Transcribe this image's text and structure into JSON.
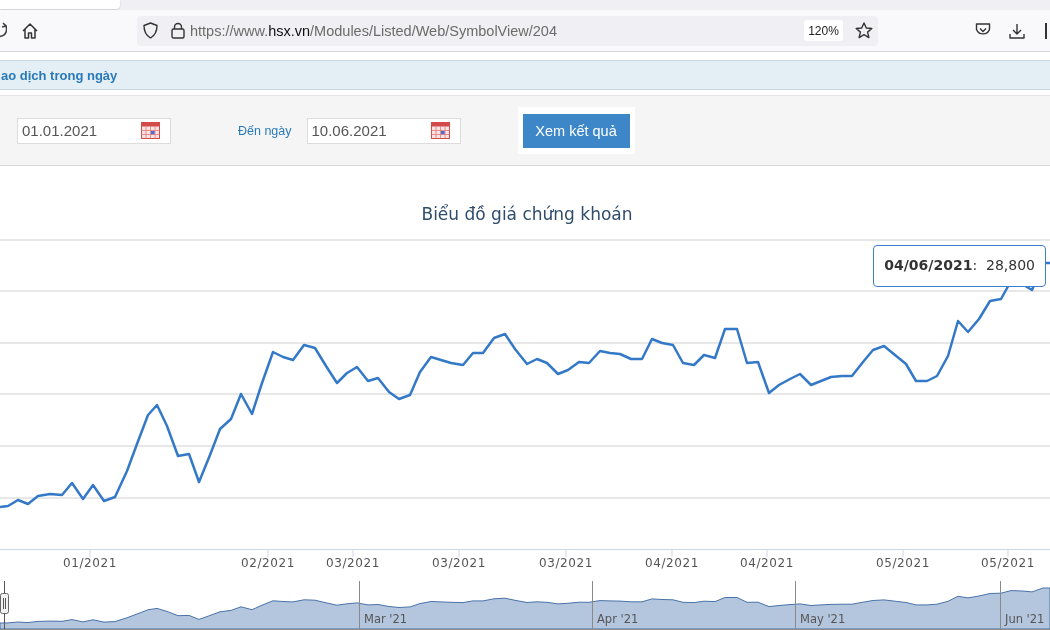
{
  "browser": {
    "url": {
      "scheme": "https://www.",
      "host": "hsx.vn",
      "path": "/Modules/Listed/Web/SymbolView/204"
    },
    "zoom": "120%"
  },
  "section": {
    "title": "ao dịch trong ngày"
  },
  "filter": {
    "from_date": "01.01.2021",
    "to_label": "Đến ngày",
    "to_date": "10.06.2021",
    "submit": "Xem kết quả"
  },
  "chart": {
    "title": "Biểu đồ giá chứng khoán",
    "x_labels": [
      "01/2021",
      "02/2021",
      "03/2021",
      "03/2021",
      "03/2021",
      "04/2021",
      "04/2021",
      "05/2021",
      "05/2021"
    ],
    "tooltip": "**04/06/2021**:  28,800",
    "navigator_labels": [
      "Mar '21",
      "Apr '21",
      "May '21",
      "Jun '21"
    ]
  }
}
